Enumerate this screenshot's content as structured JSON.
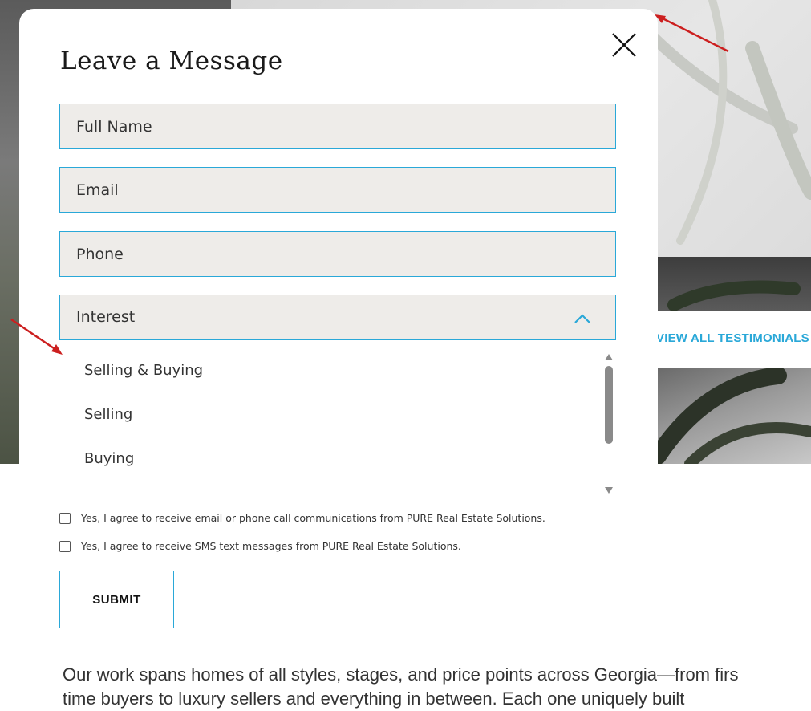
{
  "background": {
    "testimonials_link": "VIEW ALL TESTIMONIALS",
    "body_text_line1": "Our work spans homes of all styles, stages, and price points across Georgia—from firs",
    "body_text_line2": "time buyers to luxury sellers and everything in between. Each one uniquely built"
  },
  "modal": {
    "title": "Leave a Message",
    "close_icon": "close-icon",
    "fields": {
      "full_name_placeholder": "Full Name",
      "email_placeholder": "Email",
      "phone_placeholder": "Phone"
    },
    "interest_select": {
      "selected": "Interest",
      "options": [
        "Selling & Buying",
        "Selling",
        "Buying"
      ]
    },
    "consent": {
      "email_phone": "Yes, I agree to receive email or phone call communications from PURE Real Estate Solutions.",
      "sms": "Yes, I agree to receive SMS text messages from PURE Real Estate Solutions."
    },
    "submit_label": "SUBMIT"
  },
  "colors": {
    "accent": "#2aa8d8",
    "field_bg": "#eeece9",
    "annotation_arrow": "#cc1f1f"
  }
}
